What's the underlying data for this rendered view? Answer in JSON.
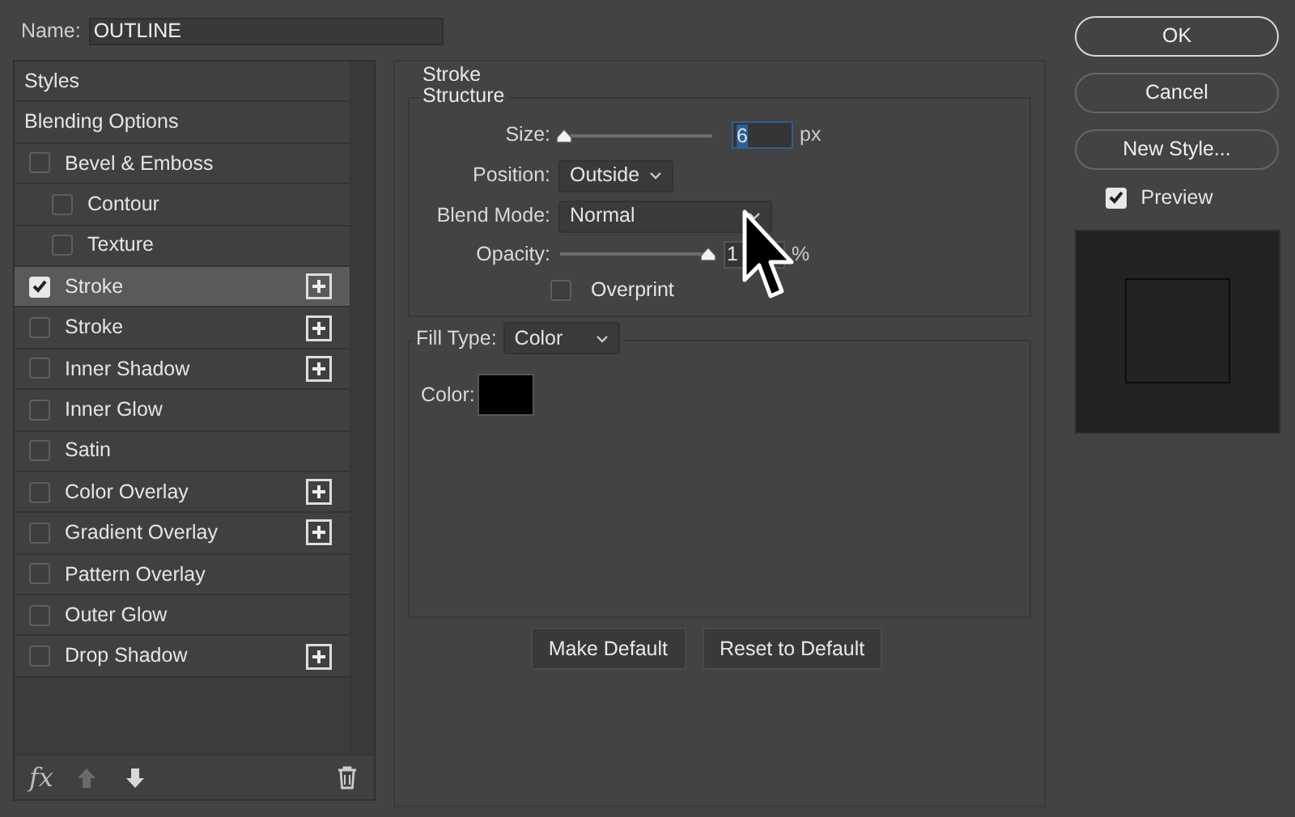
{
  "name_field": {
    "label": "Name:",
    "value": "OUTLINE"
  },
  "styles_list": {
    "items": [
      {
        "label": "Styles",
        "kind": "header",
        "selected": false
      },
      {
        "label": "Blending Options",
        "kind": "header",
        "selected": false
      },
      {
        "label": "Bevel & Emboss",
        "kind": "effect",
        "checked": false,
        "selected": false,
        "addable": false,
        "children": [
          {
            "label": "Contour",
            "kind": "effect",
            "checked": false,
            "selected": false,
            "addable": false
          },
          {
            "label": "Texture",
            "kind": "effect",
            "checked": false,
            "selected": false,
            "addable": false
          }
        ]
      },
      {
        "label": "Stroke",
        "kind": "effect",
        "checked": true,
        "selected": true,
        "addable": true
      },
      {
        "label": "Stroke",
        "kind": "effect",
        "checked": false,
        "selected": false,
        "addable": true
      },
      {
        "label": "Inner Shadow",
        "kind": "effect",
        "checked": false,
        "selected": false,
        "addable": true
      },
      {
        "label": "Inner Glow",
        "kind": "effect",
        "checked": false,
        "selected": false,
        "addable": false
      },
      {
        "label": "Satin",
        "kind": "effect",
        "checked": false,
        "selected": false,
        "addable": false
      },
      {
        "label": "Color Overlay",
        "kind": "effect",
        "checked": false,
        "selected": false,
        "addable": true
      },
      {
        "label": "Gradient Overlay",
        "kind": "effect",
        "checked": false,
        "selected": false,
        "addable": true
      },
      {
        "label": "Pattern Overlay",
        "kind": "effect",
        "checked": false,
        "selected": false,
        "addable": false
      },
      {
        "label": "Outer Glow",
        "kind": "effect",
        "checked": false,
        "selected": false,
        "addable": false
      },
      {
        "label": "Drop Shadow",
        "kind": "effect",
        "checked": false,
        "selected": false,
        "addable": true
      }
    ],
    "toolbar": {
      "fx_label": "fx",
      "move_up_disabled": true,
      "move_down_disabled": false
    }
  },
  "stroke_panel": {
    "title": "Stroke",
    "structure": {
      "title": "Structure",
      "size": {
        "label": "Size:",
        "level": 0.02,
        "value": "6",
        "unit": "px"
      },
      "position": {
        "label": "Position:",
        "value": "Outside"
      },
      "blend_mode": {
        "label": "Blend Mode:",
        "value": "Normal"
      },
      "opacity": {
        "label": "Opacity:",
        "level": 1,
        "value": "1",
        "unit": "%"
      },
      "overprint": {
        "label": "Overprint",
        "checked": false
      }
    },
    "fill_type": {
      "label": "Fill Type:",
      "value": "Color",
      "color_label": "Color:"
    },
    "buttons": [
      "Make Default",
      "Reset to Default"
    ]
  },
  "actions": [
    {
      "label": "OK",
      "default": true
    },
    {
      "label": "Cancel",
      "default": false
    },
    {
      "label": "New Style...",
      "default": false
    }
  ],
  "preview": {
    "label": "Preview",
    "checked": true
  }
}
